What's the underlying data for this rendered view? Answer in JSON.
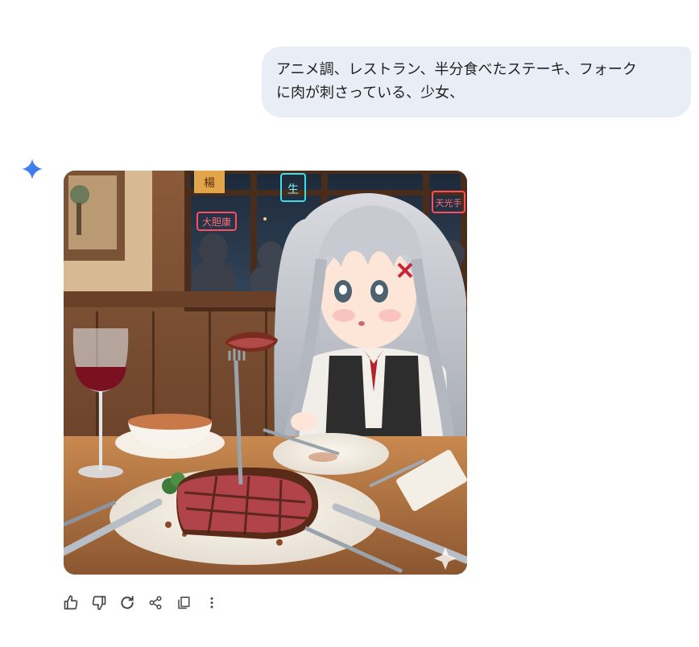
{
  "conversation": {
    "user_message": {
      "line1": "アニメ調、レストラン、半分食べたステーキ、フォーク",
      "line2": "に肉が刺さっている、少女、"
    },
    "assistant": {
      "avatar_icon": "gemini-spark-icon",
      "image": {
        "sign_left_top": "楊",
        "sign_left": "大胆康",
        "sign_right": "天光手",
        "sign_center": "生"
      },
      "actions": [
        {
          "name": "thumbs-up-icon"
        },
        {
          "name": "thumbs-down-icon"
        },
        {
          "name": "regenerate-icon"
        },
        {
          "name": "share-icon"
        },
        {
          "name": "copy-icon"
        },
        {
          "name": "more-vert-icon"
        }
      ]
    }
  },
  "colors": {
    "bubble_bg": "#e9eef6",
    "text": "#1f1f1f",
    "icon": "#444746",
    "spark_blue": "#4285f4"
  }
}
